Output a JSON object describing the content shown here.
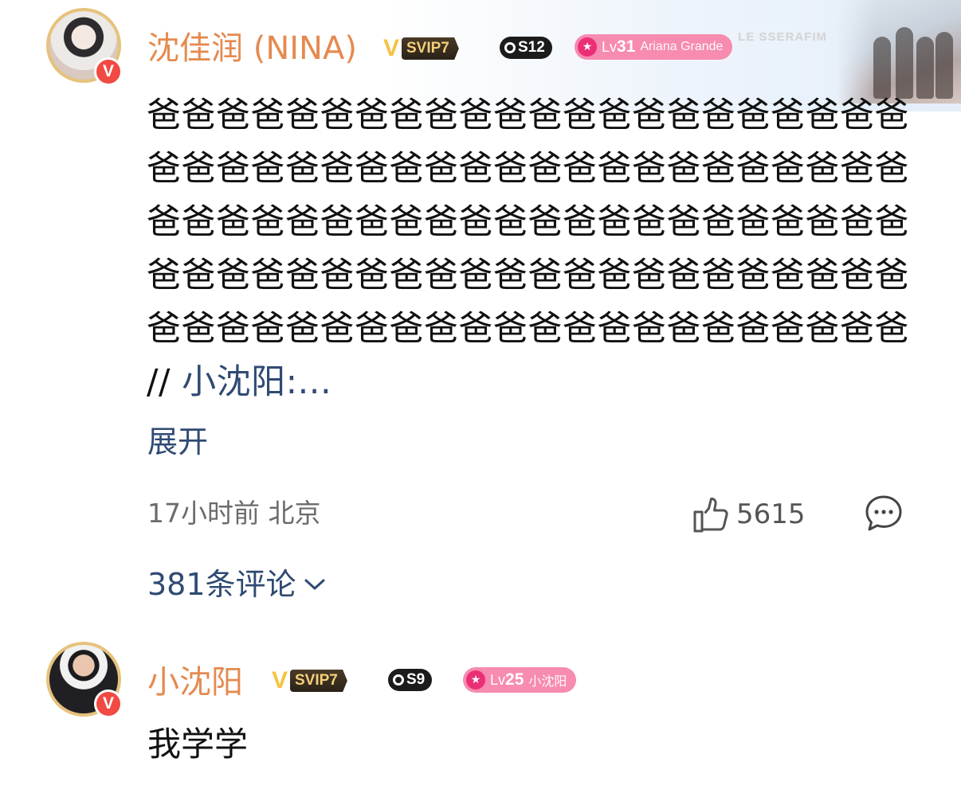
{
  "post": {
    "author": "沈佳润 (NINA)",
    "badges": {
      "svip": "SVIP7",
      "season": "S12",
      "level_prefix": "Lv",
      "level_num": "31",
      "fan_label": "Ariana Grande"
    },
    "cover_text": "LE SSERAFIM",
    "body_text": "爸爸爸爸爸爸爸爸爸爸爸爸爸爸爸爸爸爸爸爸爸爸爸爸爸爸爸爸爸爸爸爸爸爸爸爸爸爸爸爸爸爸爸爸爸爸爸爸爸爸爸爸爸爸爸爸爸爸爸爸爸爸爸爸爸爸爸爸爸爸爸爸爸爸爸爸爸爸爸爸爸爸爸爸爸爸爸爸爸爸爸爸爸爸爸爸爸爸爸爸爸爸爸爸爸爸爸爸爸爸",
    "repost_prefix": "//",
    "repost_link": "小沈阳:...",
    "expand_label": "展开",
    "meta": "17小时前 北京",
    "likes": "5615",
    "comments_label": "381条评论"
  },
  "reply": {
    "author": "小沈阳",
    "badges": {
      "svip": "SVIP7",
      "season": "S9",
      "level_prefix": "Lv",
      "level_num": "25",
      "fan_label": "小沈阳"
    },
    "text": "我学学"
  },
  "icons": {
    "like": "thumbs-up-icon",
    "comment": "speech-bubble-icon",
    "chevron": "chevron-down-icon",
    "verified": "verified-v-icon"
  },
  "colors": {
    "username": "#e58a4f",
    "link": "#2f4a73",
    "meta": "#6b6b6b",
    "level_badge": "#f78bb0",
    "verified": "#f04a43"
  }
}
